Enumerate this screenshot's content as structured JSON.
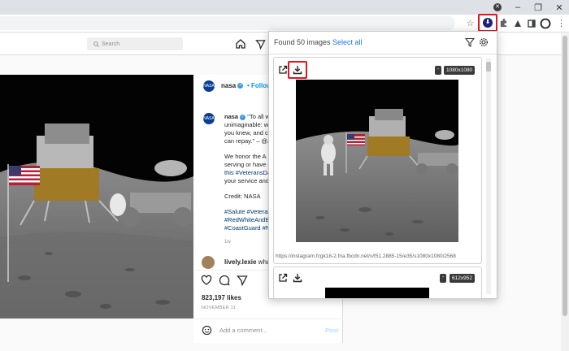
{
  "colors": {
    "highlight": "#e0161f",
    "ig_link": "#00376b",
    "accent": "#1a73e8"
  },
  "chrome": {
    "window_buttons": [
      "–",
      "❐",
      "✕"
    ],
    "icons": [
      "star-icon",
      "extension-image-downloader-icon",
      "puzzle-icon",
      "profile-flask-icon",
      "sidebar-icon",
      "profile-circle-icon",
      "menu-dots-icon"
    ]
  },
  "instagram": {
    "search_placeholder": "Search",
    "post": {
      "username": "nasa",
      "follow": "• Follow",
      "caption_lines": [
        "\"To all w",
        "unimaginable: w",
        "you knew, and c",
        "can repay.\" – @A"
      ],
      "paragraph2": [
        "We honor the A",
        "serving or have s",
        "this #VeteransDa",
        "your service and"
      ],
      "credit": "Credit: NASA",
      "hashtags": [
        "#Salute #Veterai",
        "#RedWhiteAndB",
        "#CoastGuard #N"
      ],
      "time_ago": "1w",
      "commenter": "lively.lexie",
      "comment_text": "what",
      "likes": "823,197 likes",
      "date": "NOVEMBER 11",
      "add_comment_placeholder": "Add a comment...",
      "post_button": "Post"
    }
  },
  "popup": {
    "title": "Found 50 images",
    "select_all": "Select all",
    "cards": [
      {
        "dimensions": "1080x1080",
        "url": "https://instagram.fcgk18-2.fna.fbcdn.net/v/t51.2885-15/e35/s1080x1080/2568"
      },
      {
        "dimensions": "612x952"
      }
    ]
  }
}
